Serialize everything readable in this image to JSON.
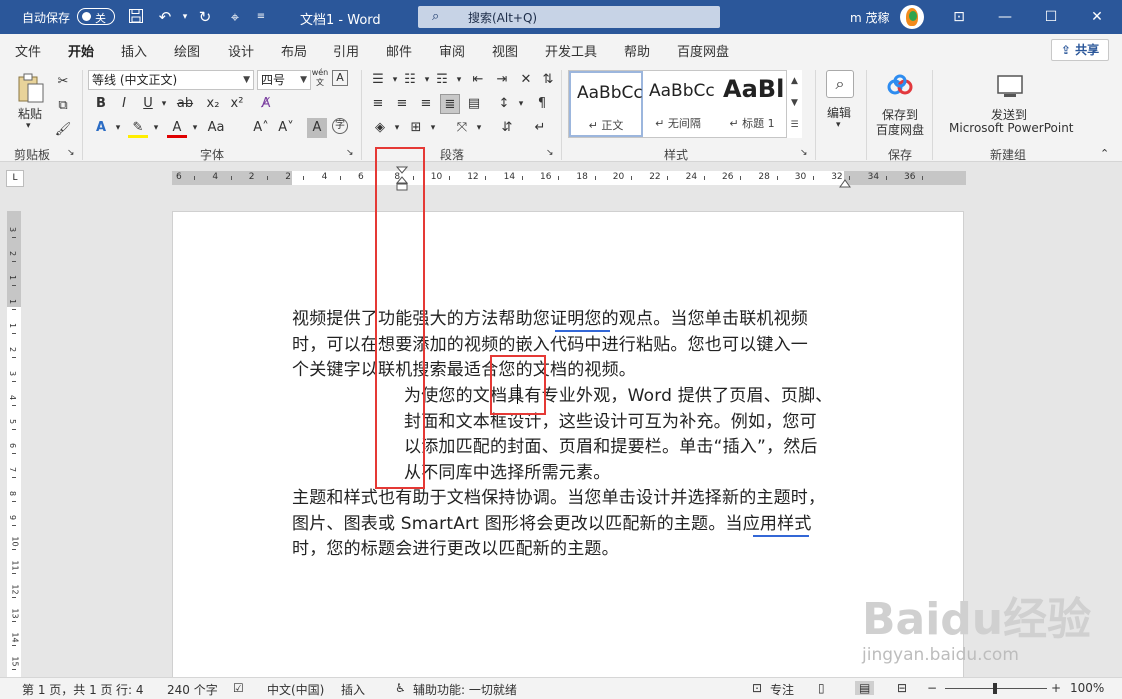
{
  "titlebar": {
    "autosave_label": "自动保存",
    "autosave_state": "关",
    "doc_title": "文档1  -  Word",
    "search_text": "搜索(Alt+Q)",
    "user_name": "m 茂稼"
  },
  "menu": {
    "tabs": [
      "文件",
      "开始",
      "插入",
      "绘图",
      "设计",
      "布局",
      "引用",
      "邮件",
      "审阅",
      "视图",
      "开发工具",
      "帮助",
      "百度网盘"
    ],
    "active_tab": "开始",
    "share_label": "共享"
  },
  "ribbon": {
    "clipboard": {
      "paste_label": "粘贴",
      "group_label": "剪贴板"
    },
    "font": {
      "font_name": "等线 (中文正文)",
      "font_size": "四号",
      "wen_label": "wén",
      "group_label": "字体"
    },
    "paragraph": {
      "group_label": "段落"
    },
    "styles": {
      "items": [
        {
          "preview": "AaBbCcI",
          "name": "正文"
        },
        {
          "preview": "AaBbCcI",
          "name": "无间隔"
        },
        {
          "preview": "AaBl",
          "name": "标题 1"
        }
      ],
      "group_label": "样式"
    },
    "editing": {
      "label": "编辑"
    },
    "save": {
      "label_line1": "保存到",
      "label_line2": "百度网盘",
      "group_label": "保存"
    },
    "newgroup": {
      "label_line1": "发送到",
      "label_line2": "Microsoft PowerPoint",
      "group_label": "新建组"
    }
  },
  "ruler": {
    "h_labels": [
      "6",
      "4",
      "2",
      "2",
      "4",
      "6",
      "8",
      "10",
      "12",
      "14",
      "16",
      "18",
      "20",
      "22",
      "24",
      "26",
      "28",
      "30",
      "32",
      "34",
      "36"
    ],
    "v_labels": [
      "3",
      "2",
      "1",
      "1",
      "1",
      "2",
      "3",
      "4",
      "5",
      "6",
      "7",
      "8",
      "9",
      "10",
      "11",
      "12",
      "13",
      "14",
      "15",
      "16"
    ],
    "corner": "L"
  },
  "document": {
    "para1": [
      "视频提供了功能强大的方法帮助您证明您的观点。当您单击联机视频",
      "时，可以在想要添加的视频的嵌入代码中进行粘贴。您也可以键入一",
      "个关键字以联机搜索最适合您的文档的视频。"
    ],
    "para2": [
      "为使您的文档具有专业外观，Word 提供了页眉、页脚、",
      "封面和文本框设计，这些设计可互为补充。例如，您可",
      "以添加匹配的封面、页眉和提要栏。单击“插入”，然后",
      "从不同库中选择所需元素。"
    ],
    "para3": [
      "主题和样式也有助于文档保持协调。当您单击设计并选择新的主题时，",
      "图片、图表或 SmartArt 图形将会更改以匹配新的主题。当应用样式",
      "时，您的标题会进行更改以匹配新的主题。"
    ]
  },
  "watermark": {
    "main": "Baidu经验",
    "sub": "jingyan.baidu.com"
  },
  "status": {
    "page": "第 1 页，共 1 页",
    "line": "行: 4",
    "words": "240 个字",
    "lang": "中文(中国)",
    "insert": "插入",
    "accessibility": "辅助功能: 一切就绪",
    "focus": "专注",
    "zoom": "100%",
    "zoom_level_percent": 100
  },
  "colors": {
    "titlebar": "#2b579a",
    "highlight_box": "#e53935",
    "underline": "#3367d6"
  }
}
